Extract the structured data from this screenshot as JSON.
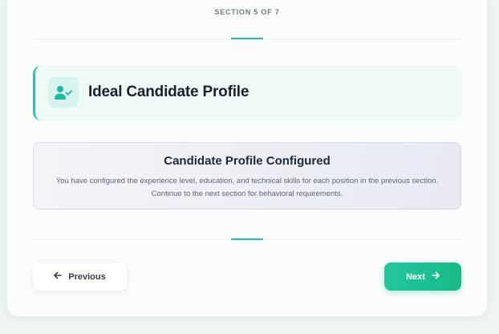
{
  "progress": {
    "label": "SECTION 5 OF 7"
  },
  "section": {
    "title": "Ideal Candidate Profile",
    "icon": "user-check-icon"
  },
  "notice": {
    "title": "Candidate Profile Configured",
    "line1": "You have configured the experience level, education, and technical skills for each position in the previous section.",
    "line2": "Continue to the next section for behavioral requirements."
  },
  "nav": {
    "previous_label": "Previous",
    "next_label": "Next"
  },
  "colors": {
    "accent": "#22c0a5",
    "next_button": "#17b985"
  }
}
